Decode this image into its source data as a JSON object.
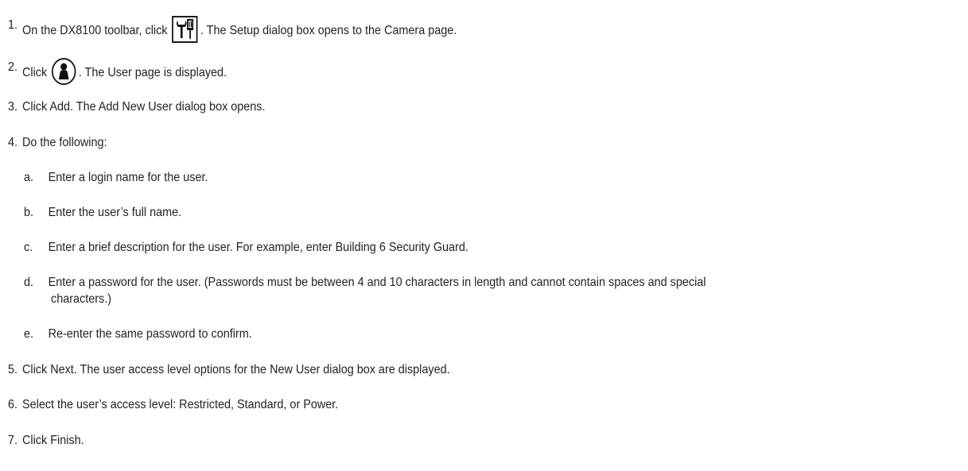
{
  "steps": [
    {
      "num": "1.",
      "before": "On the DX8100 toolbar, click",
      "icon": "setup-tools-icon",
      "after": ". The Setup dialog box opens to the Camera page."
    },
    {
      "num": "2.",
      "before": "Click",
      "icon": "user-icon",
      "after": ". The User page is displayed."
    },
    {
      "num": "3.",
      "text": "Click Add. The Add New User dialog box opens."
    },
    {
      "num": "4.",
      "text": "Do the following:"
    },
    {
      "num": "5.",
      "text": "Click Next. The user access level options for the New User dialog box are displayed."
    },
    {
      "num": "6.",
      "text": "Select the user’s access level: Restricted, Standard, or Power."
    },
    {
      "num": "7.",
      "text": "Click Finish."
    }
  ],
  "substeps": [
    {
      "letter": "a.",
      "text": "Enter a login name for the user."
    },
    {
      "letter": "b.",
      "text": "Enter the user’s full name."
    },
    {
      "letter": "c.",
      "text": "Enter a brief description for the user. For example, enter Building 6 Security Guard."
    },
    {
      "letter": "d.",
      "text": "Enter a password for the user. (Passwords must be between 4 and 10 characters in length and cannot contain spaces and special",
      "continuation": "characters.)"
    },
    {
      "letter": "e.",
      "text": "Re-enter the same password to confirm."
    }
  ]
}
